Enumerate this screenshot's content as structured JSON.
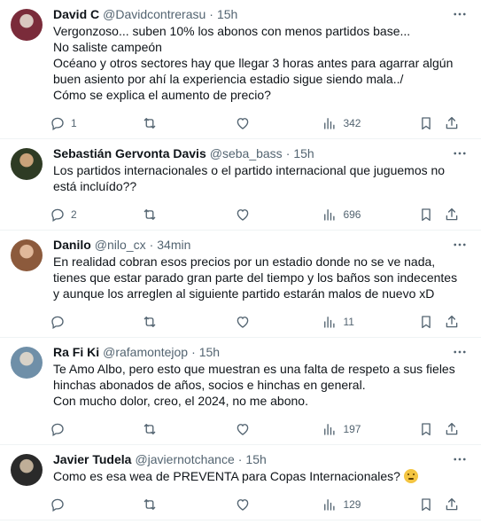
{
  "tweets": [
    {
      "name": "David C",
      "handle": "@Davidcontrerasu",
      "dot": "·",
      "time": "15h",
      "text": "Vergonzoso... suben 10% los abonos con menos partidos base...\nNo saliste campeón\nOcéano y otros sectores hay que llegar 3 horas antes para agarrar algún buen asiento por ahí la experiencia estadio sigue siendo mala../\nCómo se explica el aumento de precio?",
      "replies": "1",
      "retweets": "",
      "likes": "",
      "views": "342",
      "avatar_colors": [
        "#7a2b3a",
        "#d9c7c0"
      ]
    },
    {
      "name": "Sebastián Gervonta Davis",
      "handle": "@seba_bass",
      "dot": "·",
      "time": "15h",
      "text": "Los partidos internacionales o el partido internacional que juguemos no está incluído??",
      "replies": "2",
      "retweets": "",
      "likes": "",
      "views": "696",
      "avatar_colors": [
        "#2e3b24",
        "#c9a27a"
      ]
    },
    {
      "name": "Danilo",
      "handle": "@nilo_cx",
      "dot": "·",
      "time": "34min",
      "text": "En realidad cobran esos precios por un estadio donde no se ve nada, tienes que estar parado gran parte del tiempo y los baños son indecentes y aunque los arreglen al siguiente partido estarán malos de nuevo xD",
      "replies": "",
      "retweets": "",
      "likes": "",
      "views": "11",
      "avatar_colors": [
        "#8c5a3c",
        "#e0b89a"
      ]
    },
    {
      "name": "Ra Fi Ki",
      "handle": "@rafamontejop",
      "dot": "·",
      "time": "15h",
      "text": "Te Amo Albo, pero esto que muestran es una falta de respeto a sus fieles hinchas abonados de años, socios e hinchas en general.\nCon mucho dolor, creo, el 2024, no me abono.",
      "replies": "",
      "retweets": "",
      "likes": "",
      "views": "197",
      "avatar_colors": [
        "#6f8fa8",
        "#d8d2c8"
      ]
    },
    {
      "name": "Javier Tudela",
      "handle": "@javiernotchance",
      "dot": "·",
      "time": "15h",
      "text": "Como es esa wea de PREVENTA para Copas Internacionales? ",
      "replies": "",
      "retweets": "",
      "likes": "",
      "views": "129",
      "emoji": "thinking-face-icon",
      "avatar_colors": [
        "#2a2a2a",
        "#bfae98"
      ]
    }
  ],
  "icons": {
    "more": "more-dots-icon",
    "reply": "reply-icon",
    "retweet": "retweet-icon",
    "like": "heart-icon",
    "views": "views-bar-chart-icon",
    "bookmark": "bookmark-icon",
    "share": "share-icon"
  },
  "colors": {
    "text": "#0f1419",
    "secondary": "#536471",
    "divider": "#eff3f4"
  }
}
